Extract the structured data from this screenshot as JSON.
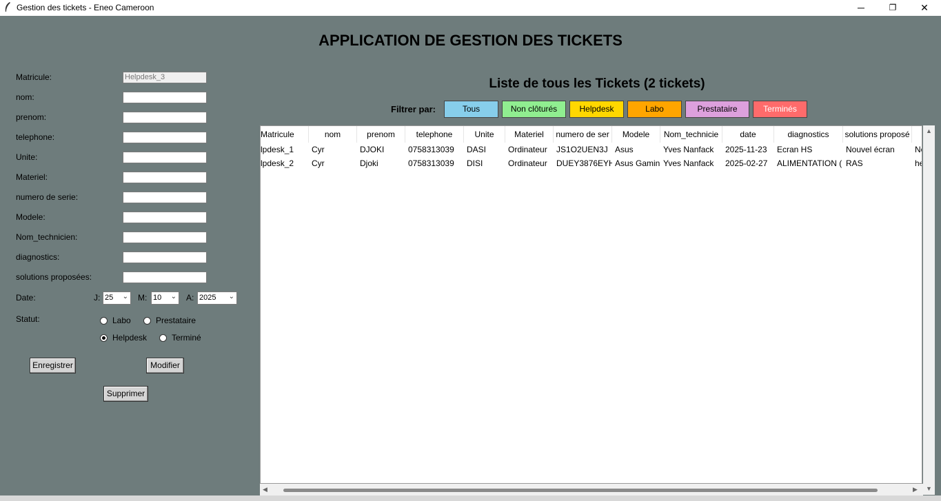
{
  "window": {
    "title": "Gestion des tickets - Eneo Cameroon",
    "minimize": "─",
    "maximize": "❐",
    "close": "✕"
  },
  "app_title": "APPLICATION DE GESTION DES TICKETS",
  "form": {
    "matricule_label": "Matricule:",
    "matricule_value": "Helpdesk_3",
    "nom_label": "nom:",
    "prenom_label": "prenom:",
    "telephone_label": "telephone:",
    "unite_label": "Unite:",
    "materiel_label": "Materiel:",
    "numero_serie_label": "numero de serie:",
    "modele_label": "Modele:",
    "nom_technicien_label": "Nom_technicien:",
    "diagnostics_label": "diagnostics:",
    "solutions_label": "solutions proposées:",
    "date_label": "Date:",
    "jour_label": "J:",
    "jour_value": "25",
    "mois_label": "M:",
    "mois_value": "10",
    "annee_label": "A:",
    "annee_value": "2025",
    "statut_label": "Statut:",
    "statut_options": {
      "labo": "Labo",
      "prestataire": "Prestataire",
      "helpdesk": "Helpdesk",
      "termine": "Terminé"
    },
    "statut_selected": "Helpdesk",
    "enregistrer": "Enregistrer",
    "modifier": "Modifier",
    "supprimer": "Supprimer"
  },
  "list": {
    "title": "Liste de tous les Tickets (2 tickets)",
    "filter_label": "Filtrer par:",
    "filters": [
      {
        "label": "Tous",
        "color": "#87ceeb"
      },
      {
        "label": "Non clôturés",
        "color": "#90ee90"
      },
      {
        "label": "Helpdesk",
        "color": "#ffd700"
      },
      {
        "label": "Labo",
        "color": "#ffa500"
      },
      {
        "label": "Prestataire",
        "color": "#dda0dd"
      },
      {
        "label": "Terminés",
        "color": "#ff6b6b"
      }
    ],
    "columns": [
      "Matricule",
      "nom",
      "prenom",
      "telephone",
      "Unite",
      "Materiel",
      "numero de ser",
      "Modele",
      "Nom_technicie",
      "date",
      "diagnostics",
      "solutions proposé",
      ""
    ],
    "rows": [
      [
        "lpdesk_1",
        "Cyr",
        "DJOKI",
        "0758313039",
        "DASI",
        "Ordinateur",
        "JS1O2UEN3J",
        "Asus",
        "Yves Nanfack",
        "2025-11-23",
        "Ecran HS",
        "Nouvel écran",
        "No"
      ],
      [
        "lpdesk_2",
        "Cyr",
        "Djoki",
        "0758313039",
        "DISI",
        "Ordinateur",
        "DUEY3876EYH.",
        "Asus Gamin",
        "Yves Nanfack",
        "2025-02-27",
        "ALIMENTATION (",
        "RAS",
        "he"
      ]
    ]
  }
}
